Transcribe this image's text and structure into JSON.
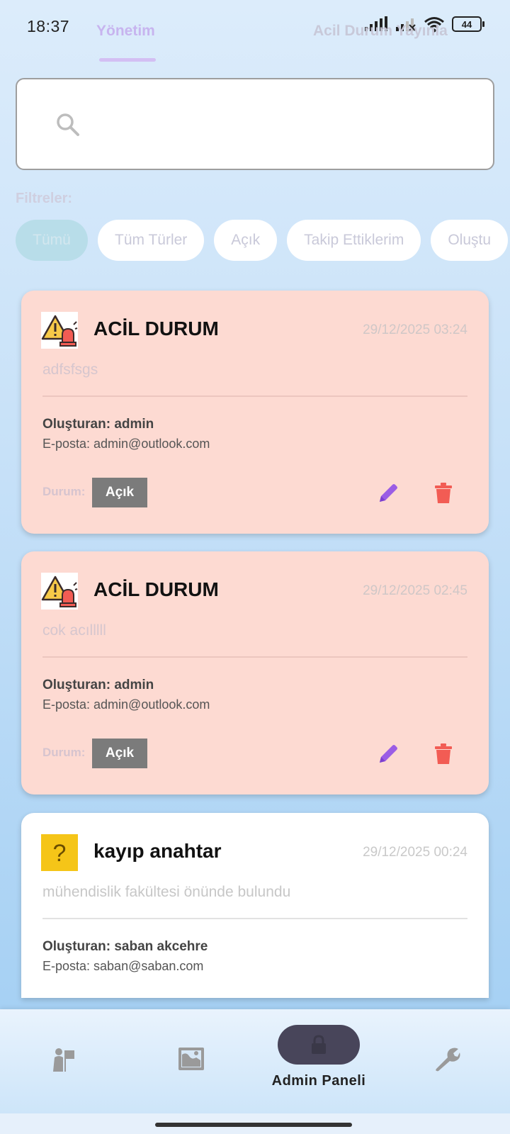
{
  "status_bar": {
    "time": "18:37",
    "battery": "44"
  },
  "tabs": [
    {
      "label": "Yönetim",
      "active": true
    },
    {
      "label": "Acil Durum Yayınla",
      "active": false
    }
  ],
  "search": {
    "placeholder": ""
  },
  "filters": {
    "label": "Filtreler:",
    "chips": [
      {
        "label": "Tümü",
        "active": true
      },
      {
        "label": "Tüm Türler",
        "active": false
      },
      {
        "label": "Açık",
        "active": false
      },
      {
        "label": "Takip Ettiklerim",
        "active": false
      },
      {
        "label": "Oluştu",
        "active": false
      }
    ]
  },
  "reports": [
    {
      "type": "emergency",
      "icon": "emergency-alarm-icon",
      "title": "ACİL DURUM",
      "date": "29/12/2025 03:24",
      "description": "adfsfsgs",
      "creator": "Oluşturan: admin",
      "email": "E-posta: admin@outlook.com",
      "status_label": "Durum:",
      "status": "Açık"
    },
    {
      "type": "emergency",
      "icon": "emergency-alarm-icon",
      "title": "ACİL DURUM",
      "date": "29/12/2025 02:45",
      "description": "cok acılllll",
      "creator": "Oluşturan: admin",
      "email": "E-posta: admin@outlook.com",
      "status_label": "Durum:",
      "status": "Açık"
    },
    {
      "type": "lost",
      "icon": "question-mark-icon",
      "title": "kayıp anahtar",
      "date": "29/12/2025 00:24",
      "description": "mühendislik fakültesi önünde bulundu",
      "creator": "Oluşturan: saban akcehre",
      "email": "E-posta: saban@saban.com"
    }
  ],
  "bottom_nav": {
    "items": [
      {
        "icon": "reports-icon"
      },
      {
        "icon": "map-icon"
      },
      {
        "icon": "lock-icon",
        "label": "Admin Paneli",
        "active": true
      },
      {
        "icon": "wrench-icon"
      }
    ]
  },
  "colors": {
    "accent": "#c7b4ef",
    "emergency_card": "#fddad2",
    "status_badge": "#7b7b7b",
    "edit": "#9b5de5",
    "delete": "#f25c54",
    "admin_pill": "#48455a"
  }
}
